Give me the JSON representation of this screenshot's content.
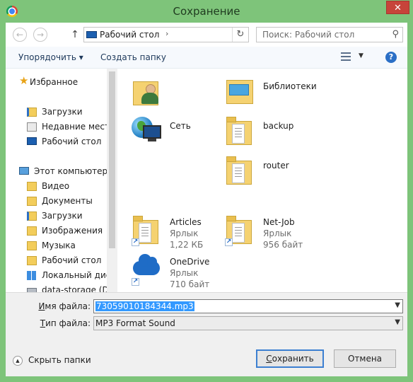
{
  "window": {
    "title": "Сохранение",
    "close_glyph": "✕"
  },
  "nav": {
    "back_glyph": "←",
    "forward_glyph": "→",
    "up_glyph": "↑",
    "address": "Рабочий стол",
    "address_chevron": "›",
    "refresh_glyph": "↻",
    "search_placeholder": "Поиск: Рабочий стол",
    "search_glyph": "⚲"
  },
  "toolbar": {
    "organize": "Упорядочить ▾",
    "new_folder": "Создать папку",
    "view_caret": "▼",
    "help": "?"
  },
  "sidebar": {
    "items": [
      {
        "label": "Избранное",
        "icon": "star-icon"
      },
      {
        "label": "Загрузки",
        "icon": "downloads-folder-icon"
      },
      {
        "label": "Недавние места",
        "icon": "recent-places-icon"
      },
      {
        "label": "Рабочий стол",
        "icon": "desktop-icon"
      },
      {
        "label": "Этот компьютер",
        "icon": "computer-icon"
      },
      {
        "label": "Видео",
        "icon": "videos-folder-icon"
      },
      {
        "label": "Документы",
        "icon": "documents-folder-icon"
      },
      {
        "label": "Загрузки",
        "icon": "downloads-folder-icon"
      },
      {
        "label": "Изображения",
        "icon": "pictures-folder-icon"
      },
      {
        "label": "Музыка",
        "icon": "music-folder-icon"
      },
      {
        "label": "Рабочий стол",
        "icon": "desktop-folder-icon"
      },
      {
        "label": "Локальный диск",
        "icon": "local-disk-icon"
      },
      {
        "label": "data-storage (D:)",
        "icon": "drive-icon"
      }
    ]
  },
  "files": [
    {
      "name": "",
      "icon": "user-folder-icon"
    },
    {
      "name": "Библиотеки",
      "icon": "libraries-icon"
    },
    {
      "name": "Сеть",
      "icon": "network-icon"
    },
    {
      "name": "backup",
      "icon": "folder-icon"
    },
    {
      "name": "router",
      "icon": "folder-icon"
    },
    {
      "name": "Articles",
      "type": "Ярлык",
      "size": "1,22 КБ",
      "icon": "folder-shortcut-icon"
    },
    {
      "name": "Net-Job",
      "type": "Ярлык",
      "size": "956 байт",
      "icon": "folder-shortcut-icon"
    },
    {
      "name": "OneDrive",
      "type": "Ярлык",
      "size": "710 байт",
      "icon": "onedrive-shortcut-icon"
    }
  ],
  "form": {
    "filename_label_u": "И",
    "filename_label_rest": "мя файла:",
    "filename_value": "73059010184344.mp3",
    "filetype_label_u": "Т",
    "filetype_label_rest": "ип файла:",
    "filetype_value": "MP3 Format Sound",
    "dropdown_glyph": "▼"
  },
  "footer": {
    "hide_arrow": "▲",
    "hide_label": "Скрыть папки",
    "save_u": "С",
    "save_rest": "охранить",
    "cancel": "Отмена"
  },
  "colors": {
    "frame": "#7ec47a",
    "close": "#c7443a",
    "accent": "#3c7fd1",
    "selection": "#3399ff"
  }
}
